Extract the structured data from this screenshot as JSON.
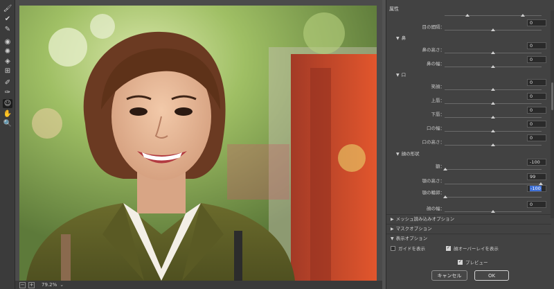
{
  "toolbar": {
    "tools": [
      {
        "icon": "face-tool-icon",
        "glyph": "🖌"
      },
      {
        "icon": "reconstruct-tool-icon",
        "glyph": "✔"
      },
      {
        "icon": "smooth-tool-icon",
        "glyph": "✎"
      },
      {
        "icon": "twirl-tool-icon",
        "glyph": "◉"
      },
      {
        "icon": "pucker-tool-icon",
        "glyph": "✺"
      },
      {
        "icon": "bloat-tool-icon",
        "glyph": "◈"
      },
      {
        "icon": "push-left-tool-icon",
        "glyph": "⊞"
      },
      {
        "icon": "freeze-mask-tool-icon",
        "glyph": "✐"
      },
      {
        "icon": "thaw-mask-tool-icon",
        "glyph": "✑"
      },
      {
        "icon": "face-select-tool-icon",
        "glyph": "☺"
      },
      {
        "icon": "hand-tool-icon",
        "glyph": "✋"
      },
      {
        "icon": "zoom-tool-icon",
        "glyph": "🔍"
      }
    ]
  },
  "zoom": {
    "value": "79.2%",
    "chevron": "⌄",
    "minus": "−",
    "plus": "+"
  },
  "panel": {
    "title": "属性",
    "rows": {
      "eye_distance": {
        "label": "目の間隔：",
        "value": "0"
      },
      "nose_group": "鼻",
      "nose_height": {
        "label": "鼻の高さ：",
        "value": "0"
      },
      "nose_width": {
        "label": "鼻の幅：",
        "value": "0"
      },
      "mouth_group": "口",
      "smile": {
        "label": "笑顔：",
        "value": "0"
      },
      "upper_lip": {
        "label": "上唇：",
        "value": "0"
      },
      "lower_lip": {
        "label": "下唇：",
        "value": "0"
      },
      "mouth_width": {
        "label": "口の幅：",
        "value": "0"
      },
      "mouth_height": {
        "label": "口の高さ：",
        "value": "0"
      },
      "face_shape_group": "顔の形状",
      "forehead": {
        "label": "額：",
        "value": "-100"
      },
      "chin_height": {
        "label": "顎の高さ：",
        "value": "99"
      },
      "jawline": {
        "label": "顎の輪郭：",
        "value": "-100"
      },
      "face_width": {
        "label": "顔の幅：",
        "value": "0"
      }
    },
    "sections": {
      "mesh": "メッシュ読み込みオプション",
      "mask": "マスクオプション",
      "view": "表示オプション"
    },
    "checks": {
      "show_guides": "ガイドを表示",
      "face_overlay": "顔オーバーレイを表示",
      "preview": "プレビュー"
    },
    "buttons": {
      "cancel": "キャンセル",
      "ok": "OK"
    }
  }
}
